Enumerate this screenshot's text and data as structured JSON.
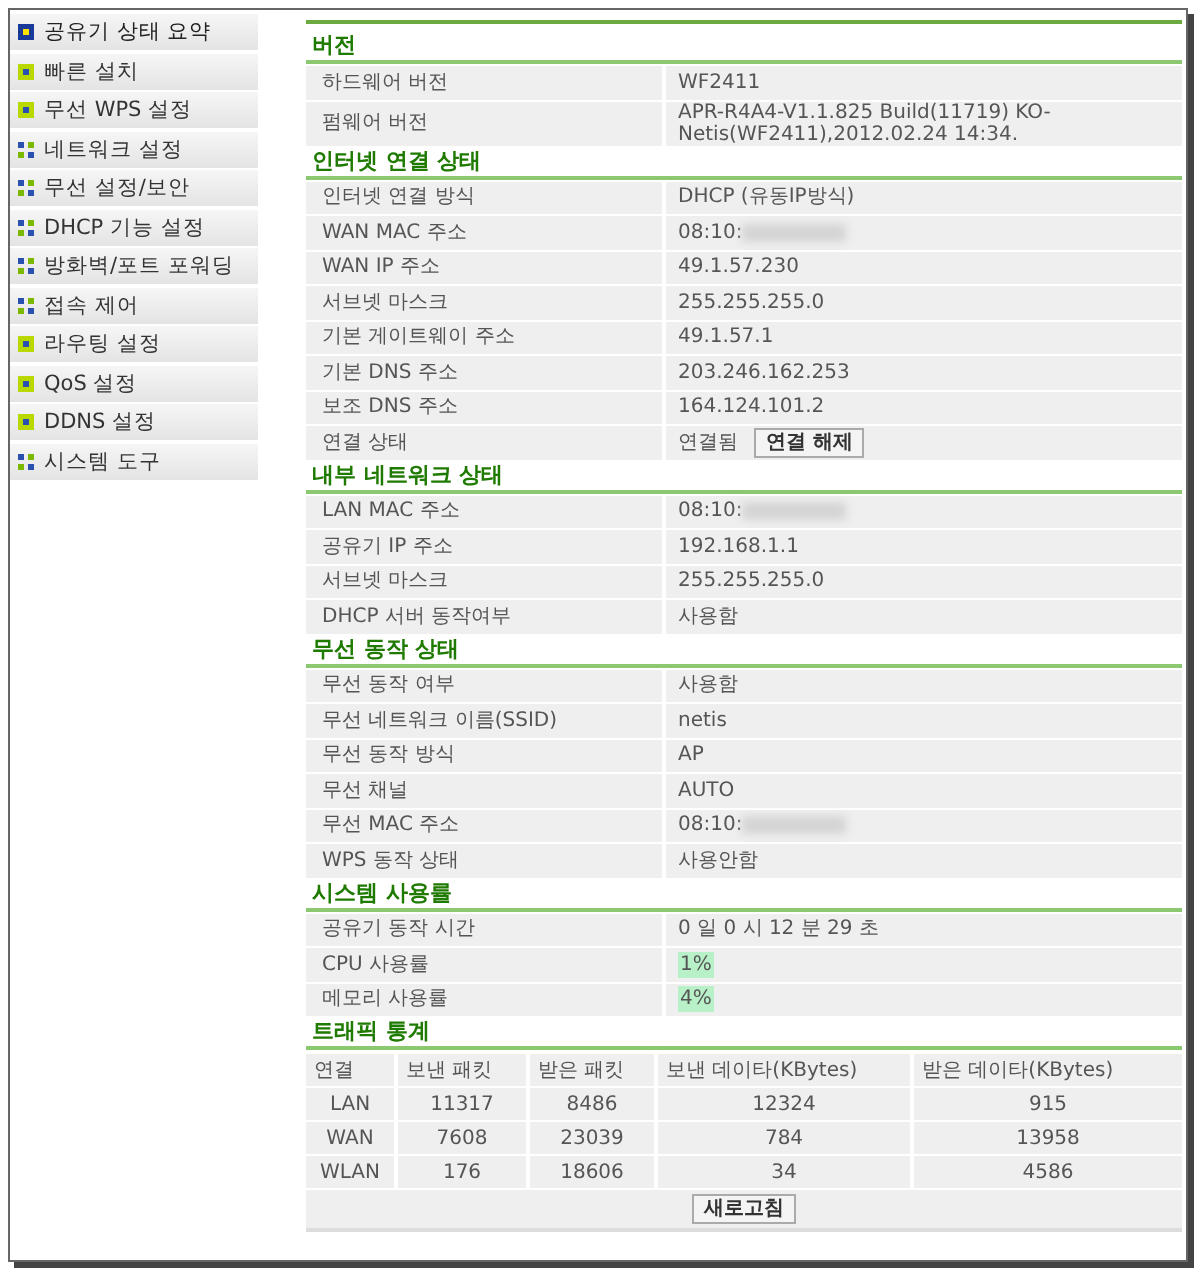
{
  "sidebar": {
    "items": [
      {
        "label": "공유기 상태 요약",
        "kind": "page",
        "selected": true
      },
      {
        "label": "빠른 설치",
        "kind": "page",
        "selected": false
      },
      {
        "label": "무선 WPS 설정",
        "kind": "page",
        "selected": false
      },
      {
        "label": "네트워크 설정",
        "kind": "menu",
        "selected": false
      },
      {
        "label": "무선 설정/보안",
        "kind": "menu",
        "selected": false
      },
      {
        "label": "DHCP 기능 설정",
        "kind": "menu",
        "selected": false
      },
      {
        "label": "방화벽/포트 포워딩",
        "kind": "menu",
        "selected": false
      },
      {
        "label": "접속 제어",
        "kind": "menu",
        "selected": false
      },
      {
        "label": "라우팅 설정",
        "kind": "page",
        "selected": false
      },
      {
        "label": "QoS 설정",
        "kind": "page",
        "selected": false
      },
      {
        "label": "DDNS 설정",
        "kind": "page",
        "selected": false
      },
      {
        "label": "시스템 도구",
        "kind": "menu",
        "selected": false
      }
    ]
  },
  "sections": [
    {
      "title": "버전",
      "rows": [
        {
          "kind": "text",
          "label": "하드웨어 버전",
          "value": "WF2411"
        },
        {
          "kind": "text",
          "label": "펌웨어 버전",
          "value": "APR-R4A4-V1.1.825 Build(11719) KO-Netis(WF2411),2012.02.24 14:34."
        }
      ]
    },
    {
      "title": "인터넷 연결 상태",
      "rows": [
        {
          "kind": "text",
          "label": "인터넷 연결 방식",
          "value": "DHCP (유동IP방식)"
        },
        {
          "kind": "masked",
          "label": "WAN MAC 주소",
          "value": "08:10:"
        },
        {
          "kind": "text",
          "label": "WAN IP 주소",
          "value": "49.1.57.230"
        },
        {
          "kind": "text",
          "label": "서브넷 마스크",
          "value": "255.255.255.0"
        },
        {
          "kind": "text",
          "label": "기본 게이트웨이 주소",
          "value": "49.1.57.1"
        },
        {
          "kind": "text",
          "label": "기본 DNS 주소",
          "value": "203.246.162.253"
        },
        {
          "kind": "text",
          "label": "보조 DNS 주소",
          "value": "164.124.101.2"
        },
        {
          "kind": "button",
          "label": "연결 상태",
          "value": "연결됨",
          "button": "연결 해제"
        }
      ]
    },
    {
      "title": "내부 네트워크 상태",
      "rows": [
        {
          "kind": "masked",
          "label": "LAN MAC 주소",
          "value": "08:10:"
        },
        {
          "kind": "text",
          "label": "공유기 IP 주소",
          "value": "192.168.1.1"
        },
        {
          "kind": "text",
          "label": "서브넷 마스크",
          "value": "255.255.255.0"
        },
        {
          "kind": "text",
          "label": "DHCP 서버 동작여부",
          "value": "사용함"
        }
      ]
    },
    {
      "title": "무선 동작 상태",
      "rows": [
        {
          "kind": "text",
          "label": "무선 동작 여부",
          "value": "사용함"
        },
        {
          "kind": "text",
          "label": "무선 네트워크 이름(SSID)",
          "value": "netis"
        },
        {
          "kind": "text",
          "label": "무선 동작 방식",
          "value": "AP"
        },
        {
          "kind": "text",
          "label": "무선 채널",
          "value": "AUTO"
        },
        {
          "kind": "masked",
          "label": "무선 MAC 주소",
          "value": "08:10:"
        },
        {
          "kind": "text",
          "label": "WPS 동작 상태",
          "value": "사용안함"
        }
      ]
    },
    {
      "title": "시스템 사용률",
      "rows": [
        {
          "kind": "text",
          "label": "공유기 동작 시간",
          "value": "0 일 0 시 12 분 29 초"
        },
        {
          "kind": "meter",
          "label": "CPU 사용률",
          "value": "1%",
          "level": 0.01
        },
        {
          "kind": "meter",
          "label": "메모리 사용률",
          "value": "4%",
          "level": 0.04
        }
      ]
    }
  ],
  "traffic": {
    "title": "트래픽 통계",
    "columns": [
      "연결",
      "보낸 패킷",
      "받은 패킷",
      "보낸 데이타(KBytes)",
      "받은 데이타(KBytes)"
    ],
    "rows": [
      [
        "LAN",
        "11317",
        "8486",
        "12324",
        "915"
      ],
      [
        "WAN",
        "7608",
        "23039",
        "784",
        "13958"
      ],
      [
        "WLAN",
        "176",
        "18606",
        "34",
        "4586"
      ]
    ],
    "refresh_button": "새로고침"
  }
}
